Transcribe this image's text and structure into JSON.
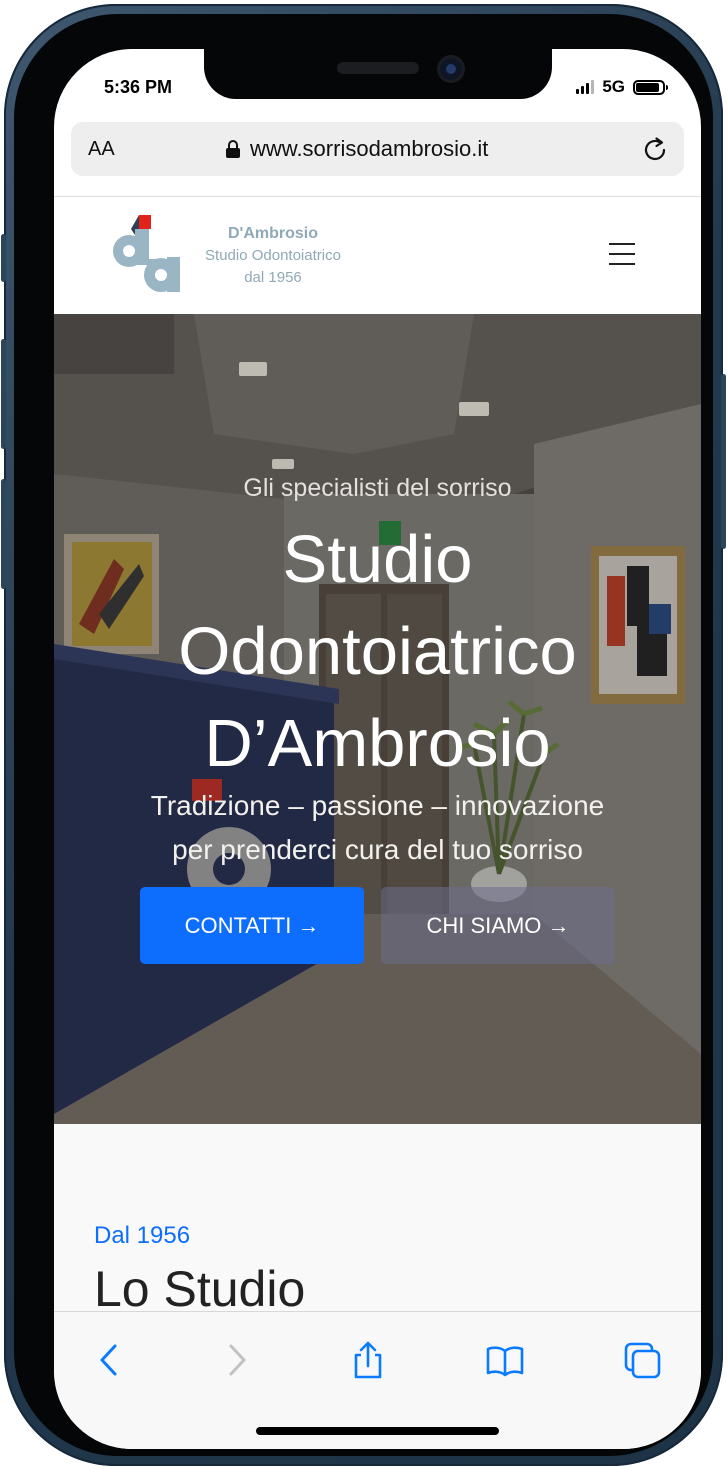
{
  "status_bar": {
    "time": "5:36 PM",
    "network": "5G",
    "battery_level": 0.9
  },
  "browser": {
    "text_size_label": "AA",
    "url": "www.sorrisodambrosio.it"
  },
  "site": {
    "logo": {
      "name": "D'Ambrosio",
      "line2": "Studio Odontoiatrico",
      "line3": "dal 1956"
    },
    "hero": {
      "subtitle": "Gli specialisti del sorriso",
      "title_lines": [
        "Studio",
        "Odontoiatrico",
        "D’Ambrosio"
      ],
      "tagline_lines": [
        "Tradizione – passione – innovazione",
        "per prenderci cura del tuo sorriso"
      ],
      "buttons": {
        "contatti": "CONTATTI →",
        "chi_siamo": "CHI SIAMO →"
      }
    },
    "about": {
      "kicker": "Dal 1956",
      "title": "Lo Studio"
    }
  },
  "toolbar": {
    "icons": [
      "back-icon",
      "forward-icon",
      "share-icon",
      "bookmarks-icon",
      "tabs-icon"
    ]
  },
  "colors": {
    "accent": "#0d6efd",
    "logo_blue": "#8fa9b7",
    "logo_red": "#e2231a",
    "frame": "#263d52"
  }
}
